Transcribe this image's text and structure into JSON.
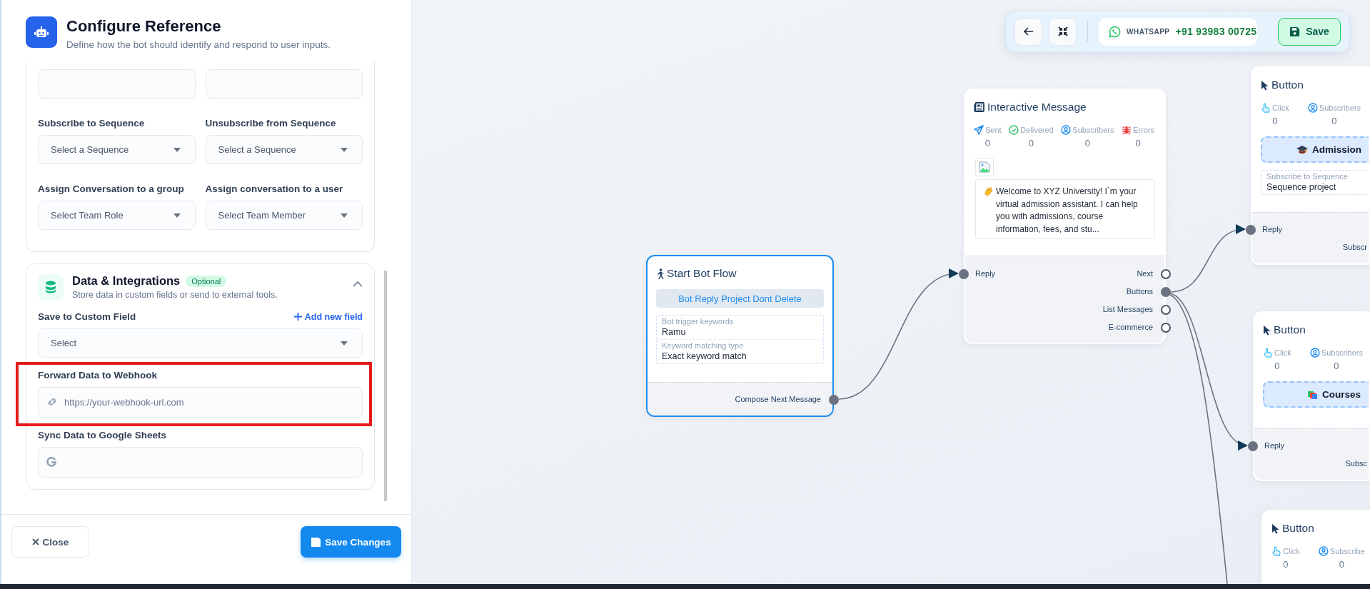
{
  "panel": {
    "title": "Configure Reference",
    "subtitle": "Define how the bot should identify and respond to user inputs.",
    "action_fields": [
      {
        "kind": "text"
      },
      {
        "kind": "text"
      },
      {
        "kind": "select",
        "label": "Subscribe to Sequence",
        "value": "Select a Sequence"
      },
      {
        "kind": "select",
        "label": "Unsubscribe from Sequence",
        "value": "Select a Sequence"
      },
      {
        "kind": "select",
        "label": "Assign Conversation to a group",
        "value": "Select Team Role"
      },
      {
        "kind": "select",
        "label": "Assign conversation to a user",
        "value": "Select Team Member"
      }
    ],
    "integrations": {
      "title": "Data & Integrations",
      "badge": "Optional",
      "subtitle": "Store data in custom fields or send to external tools.",
      "expanded": true,
      "fields": [
        {
          "kind": "select",
          "label": "Save to Custom Field",
          "link": "Add new field",
          "value": "Select",
          "highlighted": false
        },
        {
          "kind": "url",
          "label": "Forward Data to Webhook",
          "placeholder": "https://your-webhook-url.com",
          "highlighted": true
        },
        {
          "kind": "sheets",
          "label": "Sync Data to Google Sheets",
          "highlighted": false
        }
      ]
    },
    "footer": {
      "close": "Close",
      "save": "Save Changes"
    }
  },
  "toolbar": {
    "channel": "WHATSAPP",
    "phone": "+91 93983 00725",
    "save": "Save"
  },
  "nodes": [
    {
      "kind": "start",
      "title": "Start Bot Flow",
      "selected": true,
      "flow": "Bot Reply Project Dont Delete",
      "details": [
        {
          "label": "Bot trigger keywords",
          "value": "Ramu"
        },
        {
          "label": "Keyword matching type",
          "value": "Exact keyword match"
        }
      ],
      "outputs": [
        {
          "label": "Compose Next Message",
          "connected": true
        }
      ]
    },
    {
      "kind": "interactive",
      "title": "Interactive Message",
      "selected": false,
      "stats": [
        {
          "kind": "sent",
          "label": "Sent",
          "value": "0"
        },
        {
          "kind": "delivered",
          "label": "Delivered",
          "value": "0"
        },
        {
          "kind": "subscribers",
          "label": "Subscribers",
          "value": "0"
        },
        {
          "kind": "errors",
          "label": "Errors",
          "value": "0"
        }
      ],
      "message": "Welcome to XYZ University! I`m your virtual admission assistant. I can help you with admissions, course information, fees, and stu...",
      "inputs": [
        {
          "label": "Reply",
          "connected": true
        }
      ],
      "outputs": [
        {
          "label": "Next",
          "connected": false
        },
        {
          "label": "Buttons",
          "connected": true
        },
        {
          "label": "List Messages",
          "connected": false
        },
        {
          "label": "E-commerce",
          "connected": false
        }
      ]
    },
    {
      "kind": "button",
      "title": "Button",
      "selected": false,
      "stats": [
        {
          "kind": "click",
          "label": "Click",
          "value": "0"
        },
        {
          "kind": "subscribers",
          "label": "Subscribers",
          "value": "0"
        }
      ],
      "button_label": "Admission",
      "details": [
        {
          "label": "Subscribe to Sequence",
          "value": "Sequence project"
        }
      ],
      "inputs": [
        {
          "label": "Reply",
          "connected": true
        }
      ],
      "footer": "Subscr"
    },
    {
      "kind": "button",
      "title": "Button",
      "selected": false,
      "stats": [
        {
          "kind": "click",
          "label": "Click",
          "value": "0"
        },
        {
          "kind": "subscribers",
          "label": "Subscribers",
          "value": "0"
        }
      ],
      "button_label": "Courses",
      "inputs": [
        {
          "label": "Reply",
          "connected": true
        }
      ],
      "footer": "Subsc"
    },
    {
      "kind": "button",
      "title": "Button",
      "selected": false,
      "stats": [
        {
          "kind": "click",
          "label": "Click",
          "value": "0"
        },
        {
          "kind": "subscribers",
          "label": "Subscribe",
          "value": "0"
        }
      ]
    }
  ]
}
